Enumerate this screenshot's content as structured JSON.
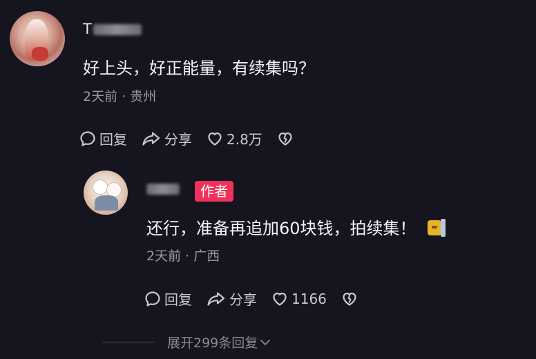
{
  "comment": {
    "username_initial": "T",
    "text": "好上头，好正能量，有续集吗？",
    "meta": "2天前 · 贵州",
    "actions": {
      "reply_label": "回复",
      "share_label": "分享",
      "like_count": "2.8万"
    },
    "avatar_icon": "user-avatar-icon"
  },
  "reply": {
    "author_badge": "作者",
    "text": "还行，准备再追加60块钱，拍续集！",
    "meta": "2天前 · 广西",
    "actions": {
      "reply_label": "回复",
      "share_label": "分享",
      "like_count": "1166"
    },
    "emoji_icon": "sticker-emoji-icon"
  },
  "expand_replies": {
    "label": "展开299条回复"
  },
  "colors": {
    "background": "#15151f",
    "author_badge": "#f0325a",
    "secondary_text": "#9a9aa5"
  }
}
